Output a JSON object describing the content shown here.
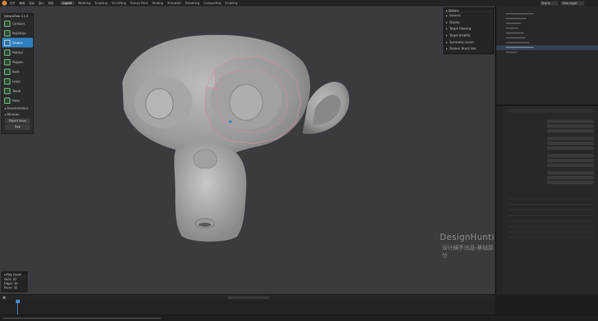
{
  "topbar": {
    "menu": [
      "文件",
      "编辑",
      "渲染",
      "窗口",
      "帮助"
    ],
    "tabs": [
      "Layout",
      "Modeling",
      "Sculpting",
      "UV Editing",
      "Texture Paint",
      "Shading",
      "Animation",
      "Rendering",
      "Compositing",
      "Scripting"
    ],
    "active_tab": "Layout",
    "scene": "Scene",
    "view_layer": "View Layer"
  },
  "retopo_panel": {
    "title": "RetopoFlow 3.1.0",
    "tools": [
      {
        "label": "Contours",
        "active": false
      },
      {
        "label": "PolyStrips",
        "active": false
      },
      {
        "label": "Strokes",
        "active": true
      },
      {
        "label": "Patches",
        "active": false
      },
      {
        "label": "Polypen",
        "active": false
      },
      {
        "label": "Knife",
        "active": false
      },
      {
        "label": "Loops",
        "active": false
      },
      {
        "label": "Tweak",
        "active": false
      },
      {
        "label": "Relax",
        "active": false
      }
    ],
    "sections": [
      "Documentation",
      "Windows"
    ],
    "report_label": "Report Issue",
    "exit_label": "Exit"
  },
  "options_panel": {
    "title": "Options",
    "items": [
      "General",
      "Display",
      "Target Cleaning",
      "Target Visibility",
      "Symmetry (none)",
      "Strokes: Brush Size"
    ]
  },
  "poly_count": {
    "title": "Poly Count",
    "verts_label": "Verts:",
    "verts": "20",
    "edges_label": "Edges:",
    "edges": "30",
    "faces_label": "Faces:",
    "faces": "10"
  },
  "watermark": {
    "line1": "DesignHunting",
    "line2": "设计捕手出品-基础部分"
  },
  "colors": {
    "accent": "#2f7ebe",
    "viewport_bg": "#3b3b3f",
    "mesh_edge": "#d88a9a"
  }
}
